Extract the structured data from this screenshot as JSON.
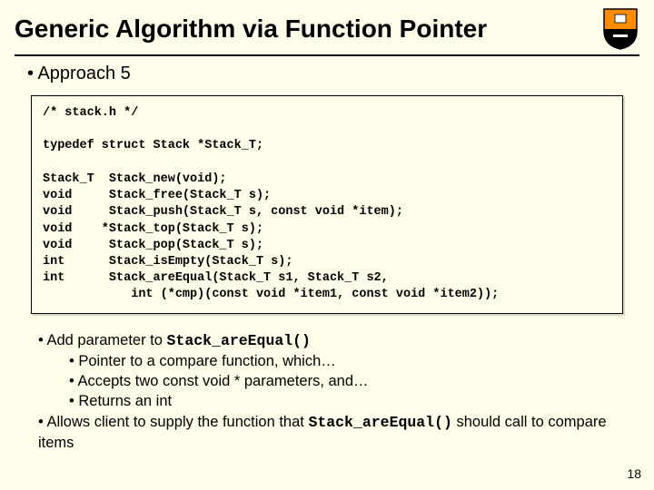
{
  "title": "Generic Algorithm via Function Pointer",
  "approach": "Approach 5",
  "code": "/* stack.h */\n\ntypedef struct Stack *Stack_T;\n\nStack_T  Stack_new(void);\nvoid     Stack_free(Stack_T s);\nvoid     Stack_push(Stack_T s, const void *item);\nvoid    *Stack_top(Stack_T s);\nvoid     Stack_pop(Stack_T s);\nint      Stack_isEmpty(Stack_T s);\nint      Stack_areEqual(Stack_T s1, Stack_T s2,\n            int (*cmp)(const void *item1, const void *item2));",
  "notes": {
    "b1_pre": "Add parameter to ",
    "b1_code": "Stack_areEqual()",
    "b1a": "Pointer to a compare function, which…",
    "b1b": "Accepts two const void * parameters, and…",
    "b1c": "Returns an int",
    "b2_pre": "Allows client to supply the function that ",
    "b2_code": "Stack_areEqual()",
    "b2_post": " should call to compare items"
  },
  "page_number": "18"
}
